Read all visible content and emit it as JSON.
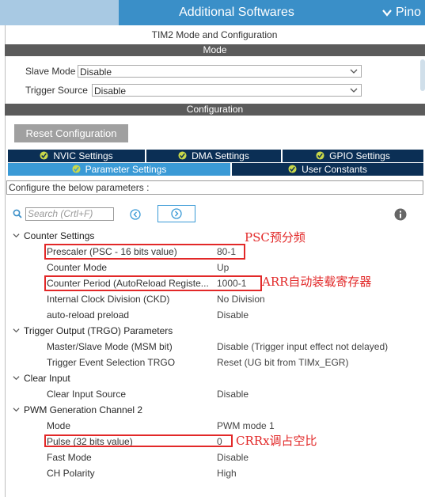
{
  "header": {
    "title": "Additional Softwares",
    "pinout_label": "Pino"
  },
  "panel_title": "TIM2 Mode and Configuration",
  "mode_section": {
    "title": "Mode",
    "slave_mode_label": "Slave Mode",
    "slave_mode_value": "Disable",
    "trigger_source_label": "Trigger Source",
    "trigger_source_value": "Disable"
  },
  "configuration_section": {
    "title": "Configuration",
    "reset_button": "Reset Configuration"
  },
  "tabs": {
    "nvic": "NVIC Settings",
    "dma": "DMA Settings",
    "gpio": "GPIO Settings",
    "parameter": "Parameter Settings",
    "user_constants": "User Constants"
  },
  "configure_hint": "Configure the below parameters :",
  "search": {
    "placeholder": "Search (Crtl+F)"
  },
  "groups": {
    "counter": {
      "title": "Counter Settings",
      "items": [
        {
          "name": "Prescaler (PSC - 16 bits value)",
          "value": "80-1"
        },
        {
          "name": "Counter Mode",
          "value": "Up"
        },
        {
          "name": "Counter Period (AutoReload Registe...",
          "value": "1000-1"
        },
        {
          "name": "Internal Clock Division (CKD)",
          "value": "No Division"
        },
        {
          "name": "auto-reload preload",
          "value": "Disable"
        }
      ]
    },
    "trgo": {
      "title": "Trigger Output (TRGO) Parameters",
      "items": [
        {
          "name": "Master/Slave Mode (MSM bit)",
          "value": "Disable (Trigger input effect not delayed)"
        },
        {
          "name": "Trigger Event Selection TRGO",
          "value": "Reset (UG bit from TIMx_EGR)"
        }
      ]
    },
    "clear": {
      "title": "Clear Input",
      "items": [
        {
          "name": "Clear Input Source",
          "value": "Disable"
        }
      ]
    },
    "pwm": {
      "title": "PWM Generation Channel 2",
      "items": [
        {
          "name": "Mode",
          "value": "PWM mode 1"
        },
        {
          "name": "Pulse (32 bits value)",
          "value": "0"
        },
        {
          "name": "Fast Mode",
          "value": "Disable"
        },
        {
          "name": "CH Polarity",
          "value": "High"
        }
      ]
    }
  },
  "annotations": {
    "psc": "PSC预分频",
    "arr": "ARR自动装载寄存器",
    "crr": "CRRx调占空比"
  },
  "colors": {
    "header_blue": "#3a8fc8",
    "tab_dark": "#0b2f55",
    "tab_active": "#3a9ad6",
    "section_gray": "#5b5b5b",
    "annotation_red": "#e22828"
  }
}
